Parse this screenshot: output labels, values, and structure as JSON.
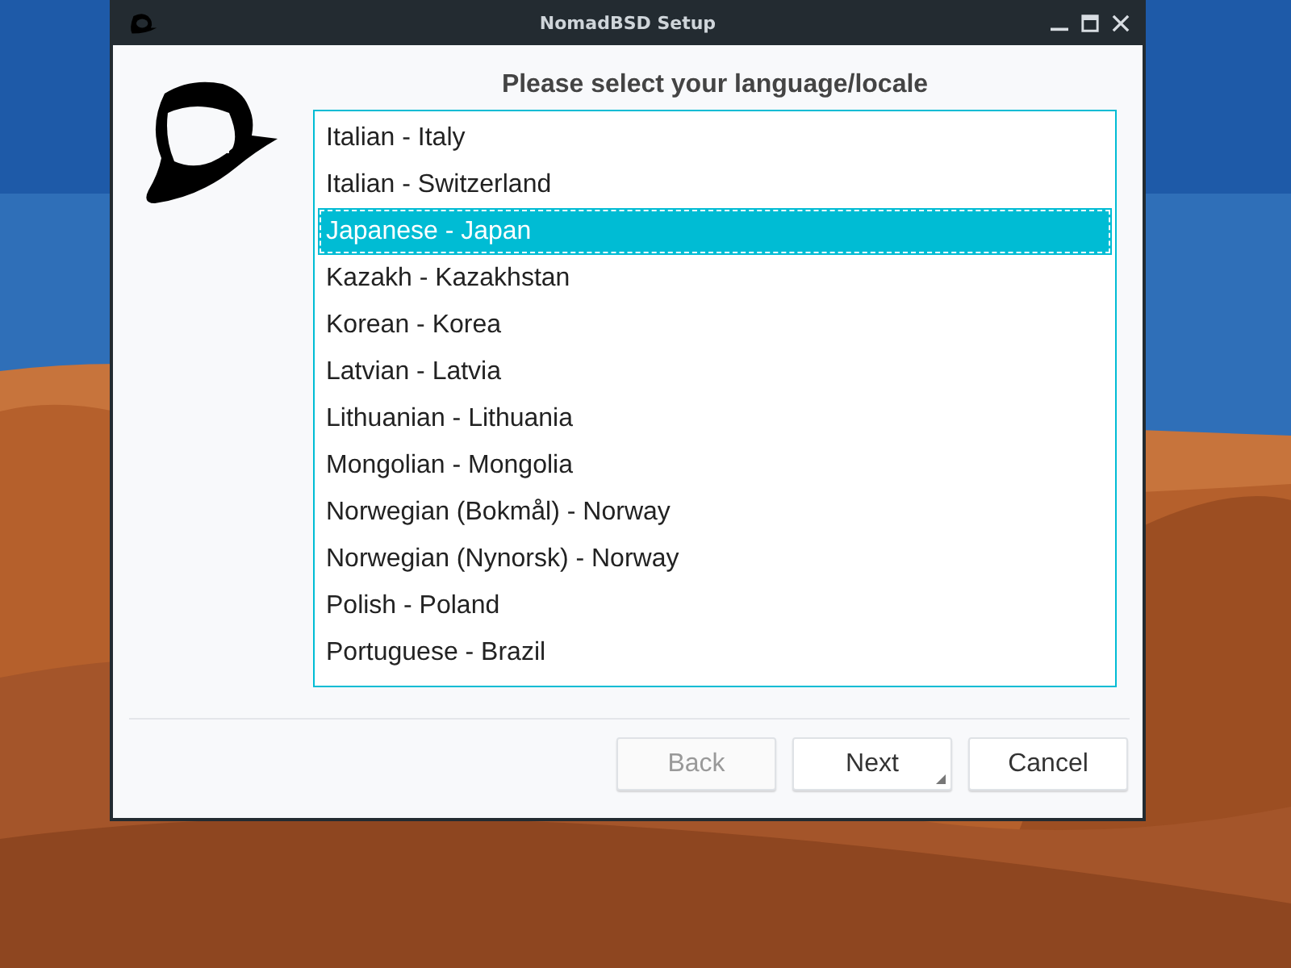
{
  "window": {
    "title": "NomadBSD Setup"
  },
  "heading": "Please select your language/locale",
  "locales": [
    {
      "label": "Italian - Italy",
      "selected": false
    },
    {
      "label": "Italian - Switzerland",
      "selected": false
    },
    {
      "label": "Japanese - Japan",
      "selected": true
    },
    {
      "label": "Kazakh - Kazakhstan",
      "selected": false
    },
    {
      "label": "Korean - Korea",
      "selected": false
    },
    {
      "label": "Latvian - Latvia",
      "selected": false
    },
    {
      "label": "Lithuanian - Lithuania",
      "selected": false
    },
    {
      "label": "Mongolian - Mongolia",
      "selected": false
    },
    {
      "label": "Norwegian (Bokmål) - Norway",
      "selected": false
    },
    {
      "label": "Norwegian (Nynorsk) - Norway",
      "selected": false
    },
    {
      "label": "Polish - Poland",
      "selected": false
    },
    {
      "label": "Portuguese - Brazil",
      "selected": false
    }
  ],
  "buttons": [
    {
      "label": "Back",
      "disabled": true,
      "default": false
    },
    {
      "label": "Next",
      "disabled": false,
      "default": true
    },
    {
      "label": "Cancel",
      "disabled": false,
      "default": false
    }
  ]
}
